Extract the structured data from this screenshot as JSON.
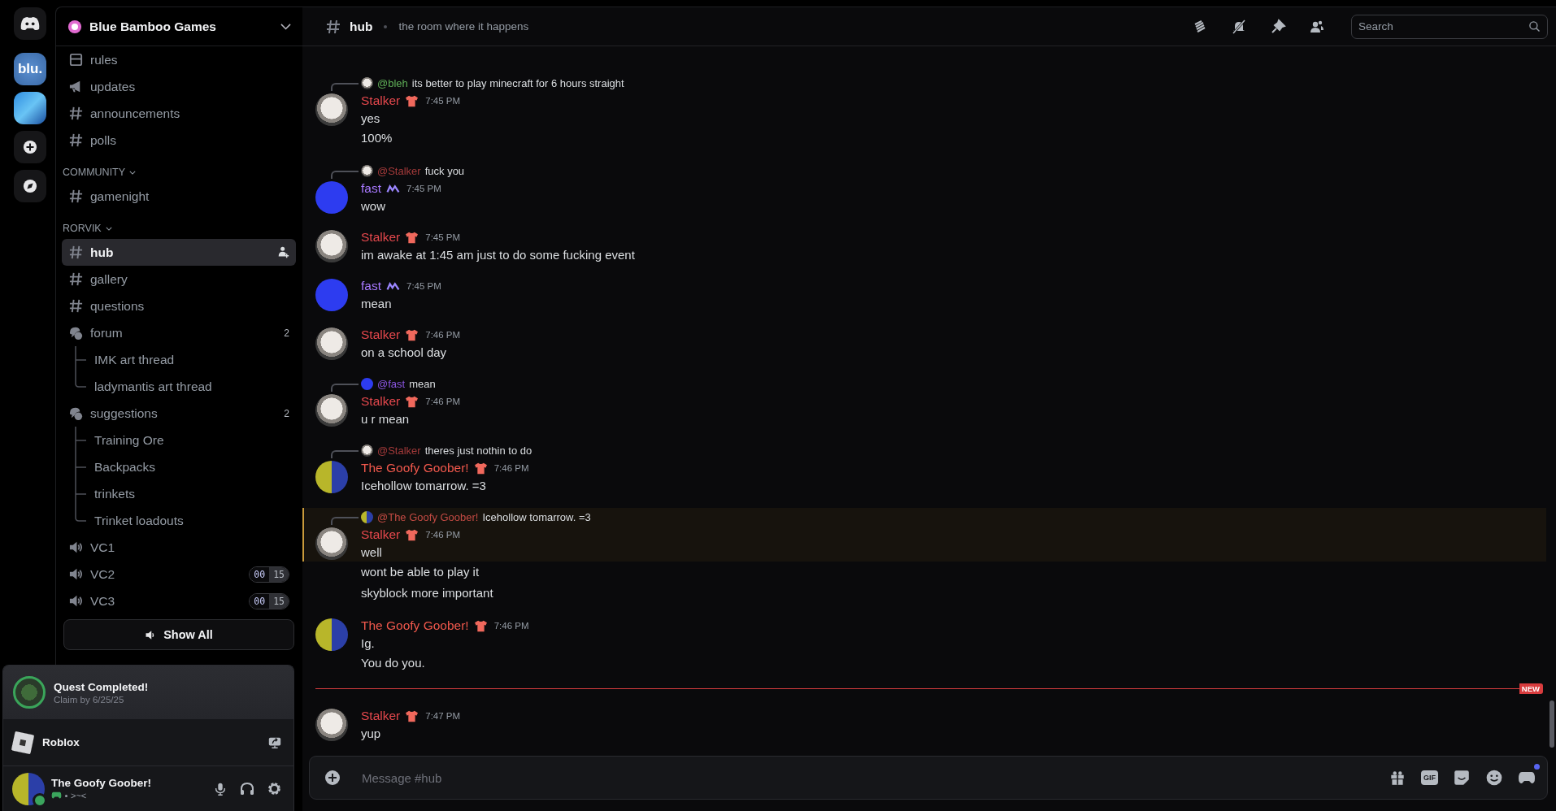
{
  "servers": [
    {
      "kind": "home"
    },
    {
      "kind": "server",
      "label": "blu."
    },
    {
      "kind": "server-art"
    },
    {
      "kind": "add"
    },
    {
      "kind": "discover"
    }
  ],
  "server": {
    "name": "Blue Bamboo Games"
  },
  "channels": [
    {
      "kind": "rules",
      "name": "rules",
      "selected": false
    },
    {
      "kind": "announcement",
      "name": "updates",
      "selected": false
    },
    {
      "kind": "text",
      "name": "announcements",
      "selected": false
    },
    {
      "kind": "text",
      "name": "polls",
      "selected": false
    },
    {
      "kind": "category",
      "name": "COMMUNITY",
      "expanded": true
    },
    {
      "kind": "text",
      "name": "gamenight",
      "selected": false
    },
    {
      "kind": "category",
      "name": "RORVIK",
      "expanded": true
    },
    {
      "kind": "text",
      "name": "hub",
      "selected": true
    },
    {
      "kind": "text",
      "name": "gallery",
      "selected": false
    },
    {
      "kind": "text",
      "name": "questions",
      "selected": false
    },
    {
      "kind": "forum",
      "name": "forum",
      "count": "2",
      "selected": false,
      "children": [
        {
          "name": "IMK art thread",
          "selected": false
        },
        {
          "name": "ladymantis art thread",
          "selected": false
        }
      ]
    },
    {
      "kind": "forum",
      "name": "suggestions",
      "count": "2",
      "selected": false,
      "children": [
        {
          "name": "Training Ore",
          "selected": false
        },
        {
          "name": "Backpacks",
          "selected": false
        },
        {
          "name": "trinkets",
          "selected": false
        },
        {
          "name": "Trinket loadouts",
          "selected": false
        }
      ]
    },
    {
      "kind": "voice",
      "name": "VC1",
      "selected": false
    },
    {
      "kind": "voice",
      "name": "VC2",
      "users": "00",
      "limit": "15",
      "selected": false
    },
    {
      "kind": "voice",
      "name": "VC3",
      "users": "00",
      "limit": "15",
      "selected": false
    }
  ],
  "show_all": {
    "label": "Show All"
  },
  "quest": {
    "title": "Quest Completed!",
    "subtitle": "Claim by 6/25/25"
  },
  "activity": {
    "name": "Roblox"
  },
  "user": {
    "name": "The Goofy Goober!",
    "status": ">~<",
    "online": true
  },
  "header": {
    "channel": "hub",
    "topic": "the room where it happens",
    "search": {
      "placeholder": "Search"
    }
  },
  "messages": [
    {
      "kind": "group",
      "reply": {
        "avatar": {
          "kind": "cat"
        },
        "name": "@bleh",
        "color": "#5fae57",
        "text": "its better to play minecraft for 6 hours straight"
      },
      "avatar": {
        "kind": "cat"
      },
      "author": "Stalker",
      "color": "#e5484d",
      "badge": {
        "kind": "shirt"
      },
      "time": "7:45 PM",
      "highlighted": false,
      "lines": [
        "yes",
        "100%"
      ]
    },
    {
      "kind": "group",
      "reply": {
        "avatar": {
          "kind": "cat"
        },
        "name": "@Stalker",
        "color": "#a33a3a",
        "text": "fuck you"
      },
      "avatar": {
        "kind": "blue"
      },
      "author": "fast",
      "color": "#a879ff",
      "badge": {
        "kind": "squiggle"
      },
      "time": "7:45 PM",
      "highlighted": false,
      "lines": [
        "wow"
      ]
    },
    {
      "kind": "group",
      "avatar": {
        "kind": "cat"
      },
      "author": "Stalker",
      "color": "#e5484d",
      "badge": {
        "kind": "shirt"
      },
      "time": "7:45 PM",
      "highlighted": false,
      "lines": [
        "im awake at 1:45 am just to do some fucking event"
      ]
    },
    {
      "kind": "group",
      "avatar": {
        "kind": "blue"
      },
      "author": "fast",
      "color": "#a879ff",
      "badge": {
        "kind": "squiggle"
      },
      "time": "7:45 PM",
      "highlighted": false,
      "lines": [
        "mean"
      ]
    },
    {
      "kind": "group",
      "avatar": {
        "kind": "cat"
      },
      "author": "Stalker",
      "color": "#e5484d",
      "badge": {
        "kind": "shirt"
      },
      "time": "7:46 PM",
      "highlighted": false,
      "lines": [
        "on a school day"
      ]
    },
    {
      "kind": "group",
      "reply": {
        "avatar": {
          "kind": "blue"
        },
        "name": "@fast",
        "color": "#8a55e0",
        "text": "mean"
      },
      "avatar": {
        "kind": "cat"
      },
      "author": "Stalker",
      "color": "#e5484d",
      "badge": {
        "kind": "shirt"
      },
      "time": "7:46 PM",
      "highlighted": false,
      "lines": [
        "u r mean"
      ]
    },
    {
      "kind": "group",
      "reply": {
        "avatar": {
          "kind": "cat"
        },
        "name": "@Stalker",
        "color": "#a33a3a",
        "text": "theres just nothin to do"
      },
      "avatar": {
        "kind": "noob"
      },
      "author": "The Goofy Goober!",
      "color": "#f0584c",
      "badge": {
        "kind": "shirt"
      },
      "time": "7:46 PM",
      "highlighted": false,
      "lines": [
        "Icehollow tomarrow. =3"
      ]
    },
    {
      "kind": "group",
      "reply": {
        "avatar": {
          "kind": "noob"
        },
        "name": "@The Goofy Goober!",
        "color": "#c24a43",
        "text": "Icehollow tomarrow. =3"
      },
      "avatar": {
        "kind": "cat"
      },
      "author": "Stalker",
      "color": "#e5484d",
      "badge": {
        "kind": "shirt"
      },
      "time": "7:46 PM",
      "highlighted": true,
      "lines": [
        "well"
      ]
    },
    {
      "kind": "followup",
      "text": "wont be able to play it"
    },
    {
      "kind": "followup",
      "text": "skyblock more important"
    },
    {
      "kind": "group",
      "avatar": {
        "kind": "noob"
      },
      "author": "The Goofy Goober!",
      "color": "#f0584c",
      "badge": {
        "kind": "shirt"
      },
      "time": "7:46 PM",
      "highlighted": false,
      "lines": [
        "Ig.",
        "You do you."
      ]
    },
    {
      "kind": "divider",
      "label": "NEW"
    },
    {
      "kind": "group",
      "avatar": {
        "kind": "cat"
      },
      "author": "Stalker",
      "color": "#e5484d",
      "badge": {
        "kind": "shirt"
      },
      "time": "7:47 PM",
      "highlighted": false,
      "lines": [
        "yup"
      ]
    }
  ],
  "composer": {
    "placeholder": "Message #hub",
    "gif_label": "GIF",
    "notification": true
  }
}
